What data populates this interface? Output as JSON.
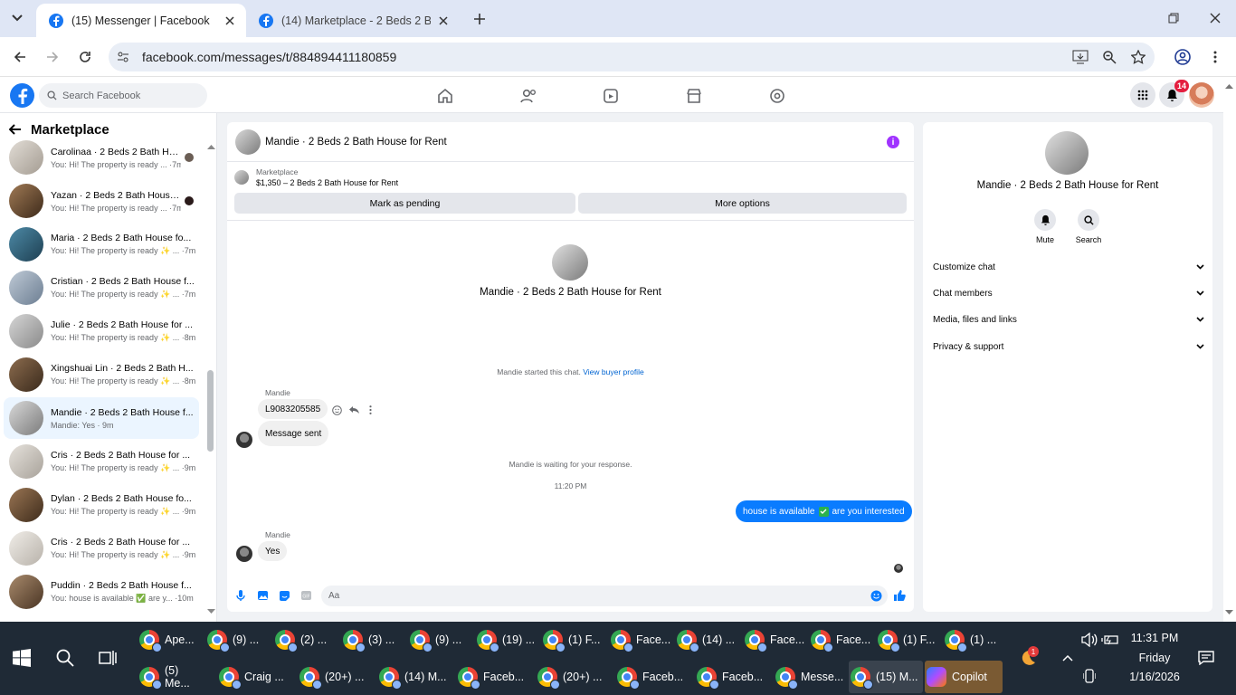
{
  "browser": {
    "tabs": [
      {
        "title": "(15) Messenger | Facebook",
        "active": true
      },
      {
        "title": "(14) Marketplace - 2 Beds 2 Bat",
        "active": false
      }
    ],
    "url": "facebook.com/messages/t/884894411180859"
  },
  "fbnav": {
    "search_placeholder": "Search Facebook",
    "notification_count": "14"
  },
  "sidebar": {
    "title": "Marketplace",
    "conversations": [
      {
        "name": "Carolinaa · 2 Beds 2 Bath Ho...",
        "preview": "You: Hi! The property is ready ... ·7m",
        "thumb": "#c9c3bb"
      },
      {
        "name": "Yazan · 2 Beds 2 Bath House ...",
        "preview": "You: Hi! The property is ready ... ·7m",
        "thumb": "#7b5a3c"
      },
      {
        "name": "Maria · 2 Beds 2 Bath House fo...",
        "preview": "You: Hi! The property is ready ✨ ... ·7m",
        "thumb": "#3e6f86"
      },
      {
        "name": "Cristian · 2 Beds 2 Bath House f...",
        "preview": "You: Hi! The property is ready ✨ ... ·7m",
        "thumb": "#9fb0c2"
      },
      {
        "name": "Julie · 2 Beds 2 Bath House for ...",
        "preview": "You: Hi! The property is ready ✨ ... ·8m",
        "thumb": "#b5b5b5"
      },
      {
        "name": "Xingshuai Lin · 2 Beds 2 Bath H...",
        "preview": "You: Hi! The property is ready ✨ ... ·8m",
        "thumb": "#5d4632"
      },
      {
        "name": "Mandie · 2 Beds 2 Bath House f...",
        "preview": "Mandie: Yes · 9m",
        "thumb": "#a9a9a9"
      },
      {
        "name": "Cris · 2 Beds 2 Bath House for ...",
        "preview": "You: Hi! The property is ready ✨ ... ·9m",
        "thumb": "#c8c4be"
      },
      {
        "name": "Dylan · 2 Beds 2 Bath House fo...",
        "preview": "You: Hi! The property is ready ✨ ... ·9m",
        "thumb": "#6e4f35"
      },
      {
        "name": "Cris · 2 Beds 2 Bath House for ...",
        "preview": "You: Hi! The property is ready ✨ ... ·9m",
        "thumb": "#d6d2cc"
      },
      {
        "name": "Puddin · 2 Beds 2 Bath House f...",
        "preview": "You: house is available ✅ are y... ·10m",
        "thumb": "#8a6d52"
      }
    ]
  },
  "chat": {
    "header_name": "Mandie · 2 Beds 2 Bath House for Rent",
    "marketplace_label": "Marketplace",
    "listing": "$1,350 – 2 Beds 2 Bath House for Rent",
    "mark_pending": "Mark as pending",
    "more_options": "More options",
    "center_name": "Mandie · 2 Beds 2 Bath House for Rent",
    "started_text": "Mandie started this chat.",
    "view_profile": "View buyer profile",
    "sender_name_1": "Mandie",
    "msg_code": "L9083205585",
    "msg_sent": "Message sent",
    "waiting_text": "Mandie is waiting for your response.",
    "time_stamp": "11:20 PM",
    "my_msg_a": "house is available",
    "my_msg_b": "are you interested",
    "sender_name_2": "Mandie",
    "msg_yes": "Yes",
    "composer_placeholder": "Aa"
  },
  "info": {
    "name": "Mandie · 2 Beds 2 Bath House for Rent",
    "mute": "Mute",
    "search": "Search",
    "rows": [
      "Customize chat",
      "Chat members",
      "Media, files and links",
      "Privacy & support"
    ]
  },
  "taskbar": {
    "row1": [
      "Ape...",
      "(9) ...",
      "(2) ...",
      "(3) ...",
      "(9) ...",
      "(19) ...",
      "(1) F...",
      "Face...",
      "(14) ...",
      "Face...",
      "Face...",
      "(1) F...",
      "(1) ..."
    ],
    "row2": [
      "(5) Me...",
      "Craig ...",
      "(20+) ...",
      "(14) M...",
      "Faceb...",
      "(20+) ...",
      "Faceb...",
      "Faceb...",
      "Messe...",
      "(15) M..."
    ],
    "copilot": "Copilot",
    "weather_badge": "1",
    "time": "11:31 PM",
    "day": "Friday",
    "date": "1/16/2026"
  },
  "colors": {
    "fb_blue": "#1877f2",
    "messenger_blue": "#0a7cff",
    "tab_strip": "#dfe6f5",
    "taskbar": "#1f2a36"
  }
}
